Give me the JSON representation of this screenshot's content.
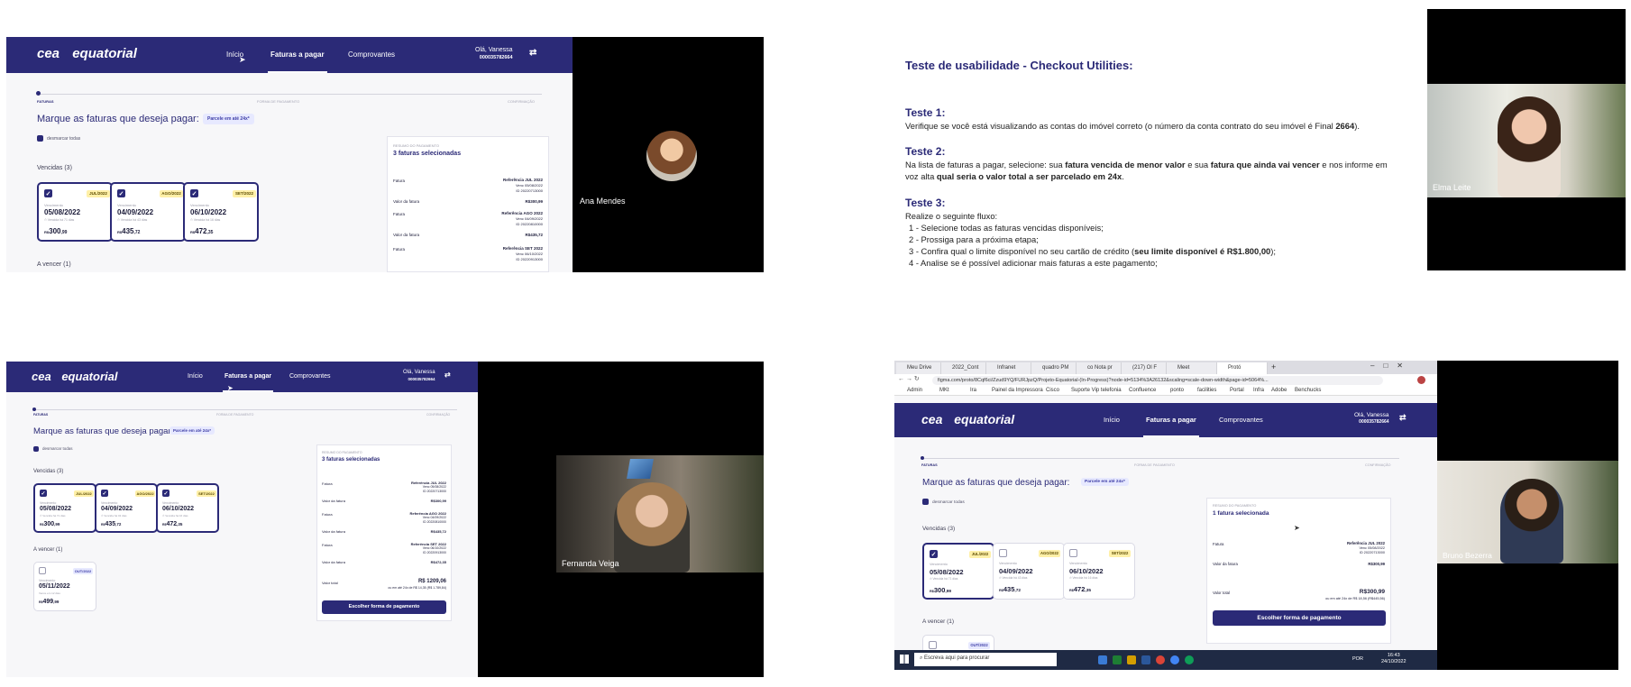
{
  "app": {
    "brand_cea": "cea",
    "brand_grupo": "GRUPO",
    "brand_equatorial": "equatorial",
    "brand_energia": "ENERGIA",
    "nav": [
      "Início",
      "Faturas a pagar",
      "Comprovantes"
    ],
    "user_greeting": "Olá, Vanessa",
    "user_account": "000035782664",
    "steps": [
      "FATURAS",
      "FORMA DE PAGAMENTO",
      "CONFIRMAÇÃO"
    ],
    "heading": "Marque as faturas que deseja pagar:",
    "installments_pill": "Parcele em até 24x*",
    "deselect_all": "desmarcar todas",
    "overdue_section": "Vencidas (3)",
    "upcoming_section": "A vencer (1)",
    "card_label": "Vencimento",
    "cards": [
      {
        "tag": "JUL/2022",
        "date": "05/08/2022",
        "due": "Vencida há 71 dias",
        "currency": "R$",
        "amount": "300",
        "cents": ",99"
      },
      {
        "tag": "AGO/2022",
        "date": "04/09/2022",
        "due": "Vencida há 43 dias",
        "currency": "R$",
        "amount": "435",
        "cents": ",72"
      },
      {
        "tag": "SET/2022",
        "date": "06/10/2022",
        "due": "Vencida há 16 dias",
        "currency": "R$",
        "amount": "472",
        "cents": ",35"
      }
    ],
    "upcoming_card": {
      "tag": "OUT/2022",
      "date": "05/11/2022",
      "due": "Vence em 12 dias",
      "currency": "R$",
      "amount": "499",
      "cents": ",99"
    },
    "summary": {
      "label": "RESUMO DO PAGAMENTO",
      "title_three": "3 faturas selecionadas",
      "title_one": "1 fatura selecionada",
      "fatura_label": "Fatura",
      "valor_label": "Valor da fatura",
      "items": [
        {
          "ref": "Referência JUL 2022",
          "venc": "Venc 05/08/2022",
          "id": "ID 20220713000",
          "valor": "R$300,99"
        },
        {
          "ref": "Referência AGO 2022",
          "venc": "Venc 04/09/2022",
          "id": "ID 20220810000",
          "valor": "R$435,72"
        },
        {
          "ref": "Referência SET 2022",
          "venc": "Venc 06/10/2022",
          "id": "ID 20220913000",
          "valor": "R$472,35"
        }
      ],
      "total_label": "Valor total",
      "total_three": "R$ 1209,06",
      "installment_three": "ou em até 24x de R$ 14,35 (R$ 1.789,84)",
      "total_one": "R$300,99",
      "installment_one": "ou em até 24x de R$ 18,56 (R$445,56)",
      "button": "Escolher forma de pagamento"
    }
  },
  "participants": {
    "ana": "Ana Mendes",
    "elma": "Elma Leite",
    "fernanda": "Fernanda Veiga",
    "bruno": "Bruno Bezerra"
  },
  "doc": {
    "title": "Teste de usabilidade - Checkout Utilities:",
    "t1_h": "Teste 1:",
    "t1_a": "Verifique se você está visualizando as contas do imóvel correto (o número da conta contrato do seu imóvel é Final ",
    "t1_b": "2664",
    "t1_c": ").",
    "t2_h": "Teste 2:",
    "t2_a": "Na lista de faturas a pagar, selecione: sua ",
    "t2_b": "fatura vencida de menor valor",
    "t2_c": " e sua ",
    "t2_d": "fatura que ainda vai vencer",
    "t2_e": " e nos informe em",
    "t2_f": "voz alta ",
    "t2_g": "qual seria o valor total a ser parcelado em 24x",
    "t2_h2": ".",
    "t3_h": "Teste 3:",
    "t3_intro": "Realize o seguinte fluxo:",
    "t3_1": "1 - Selecione todas as faturas vencidas disponíveis;",
    "t3_2": "2 - Prossiga para a próxima etapa;",
    "t3_3a": "3 - Confira qual o limite disponível no seu cartão de crédito (",
    "t3_3b": "seu limite disponível é R$1.800,00",
    "t3_3c": ");",
    "t3_4": "4 - Analise se é possível adicionar mais faturas a este pagamento;"
  },
  "browser": {
    "tabs": [
      "Meu Drive",
      "2022_Cont",
      "Infranet",
      "quadro PM",
      "co Nota pr",
      "(217) Ol F",
      "Meet",
      "Protó"
    ],
    "url": "figma.com/proto/8Cqf6ci/Zzud9YQ/FURJpzQ/Projeto-Equatorial-(In-Progress)?node-id=5134%3A26132&scaling=scale-down-width&page-id=5064%...",
    "bookmarks": [
      "Admin",
      "MKt",
      "Ira",
      "Painel da Impressora",
      "Cisco",
      "Suporte Vip telefonia",
      "Confluence",
      "ponto",
      "facilities",
      "Portal",
      "Infra",
      "Adobe",
      "Benchucks"
    ],
    "taskbar_search": "Escreva aqui para procurar",
    "time": "16:43",
    "date": "24/10/2022",
    "lang": "POR"
  }
}
